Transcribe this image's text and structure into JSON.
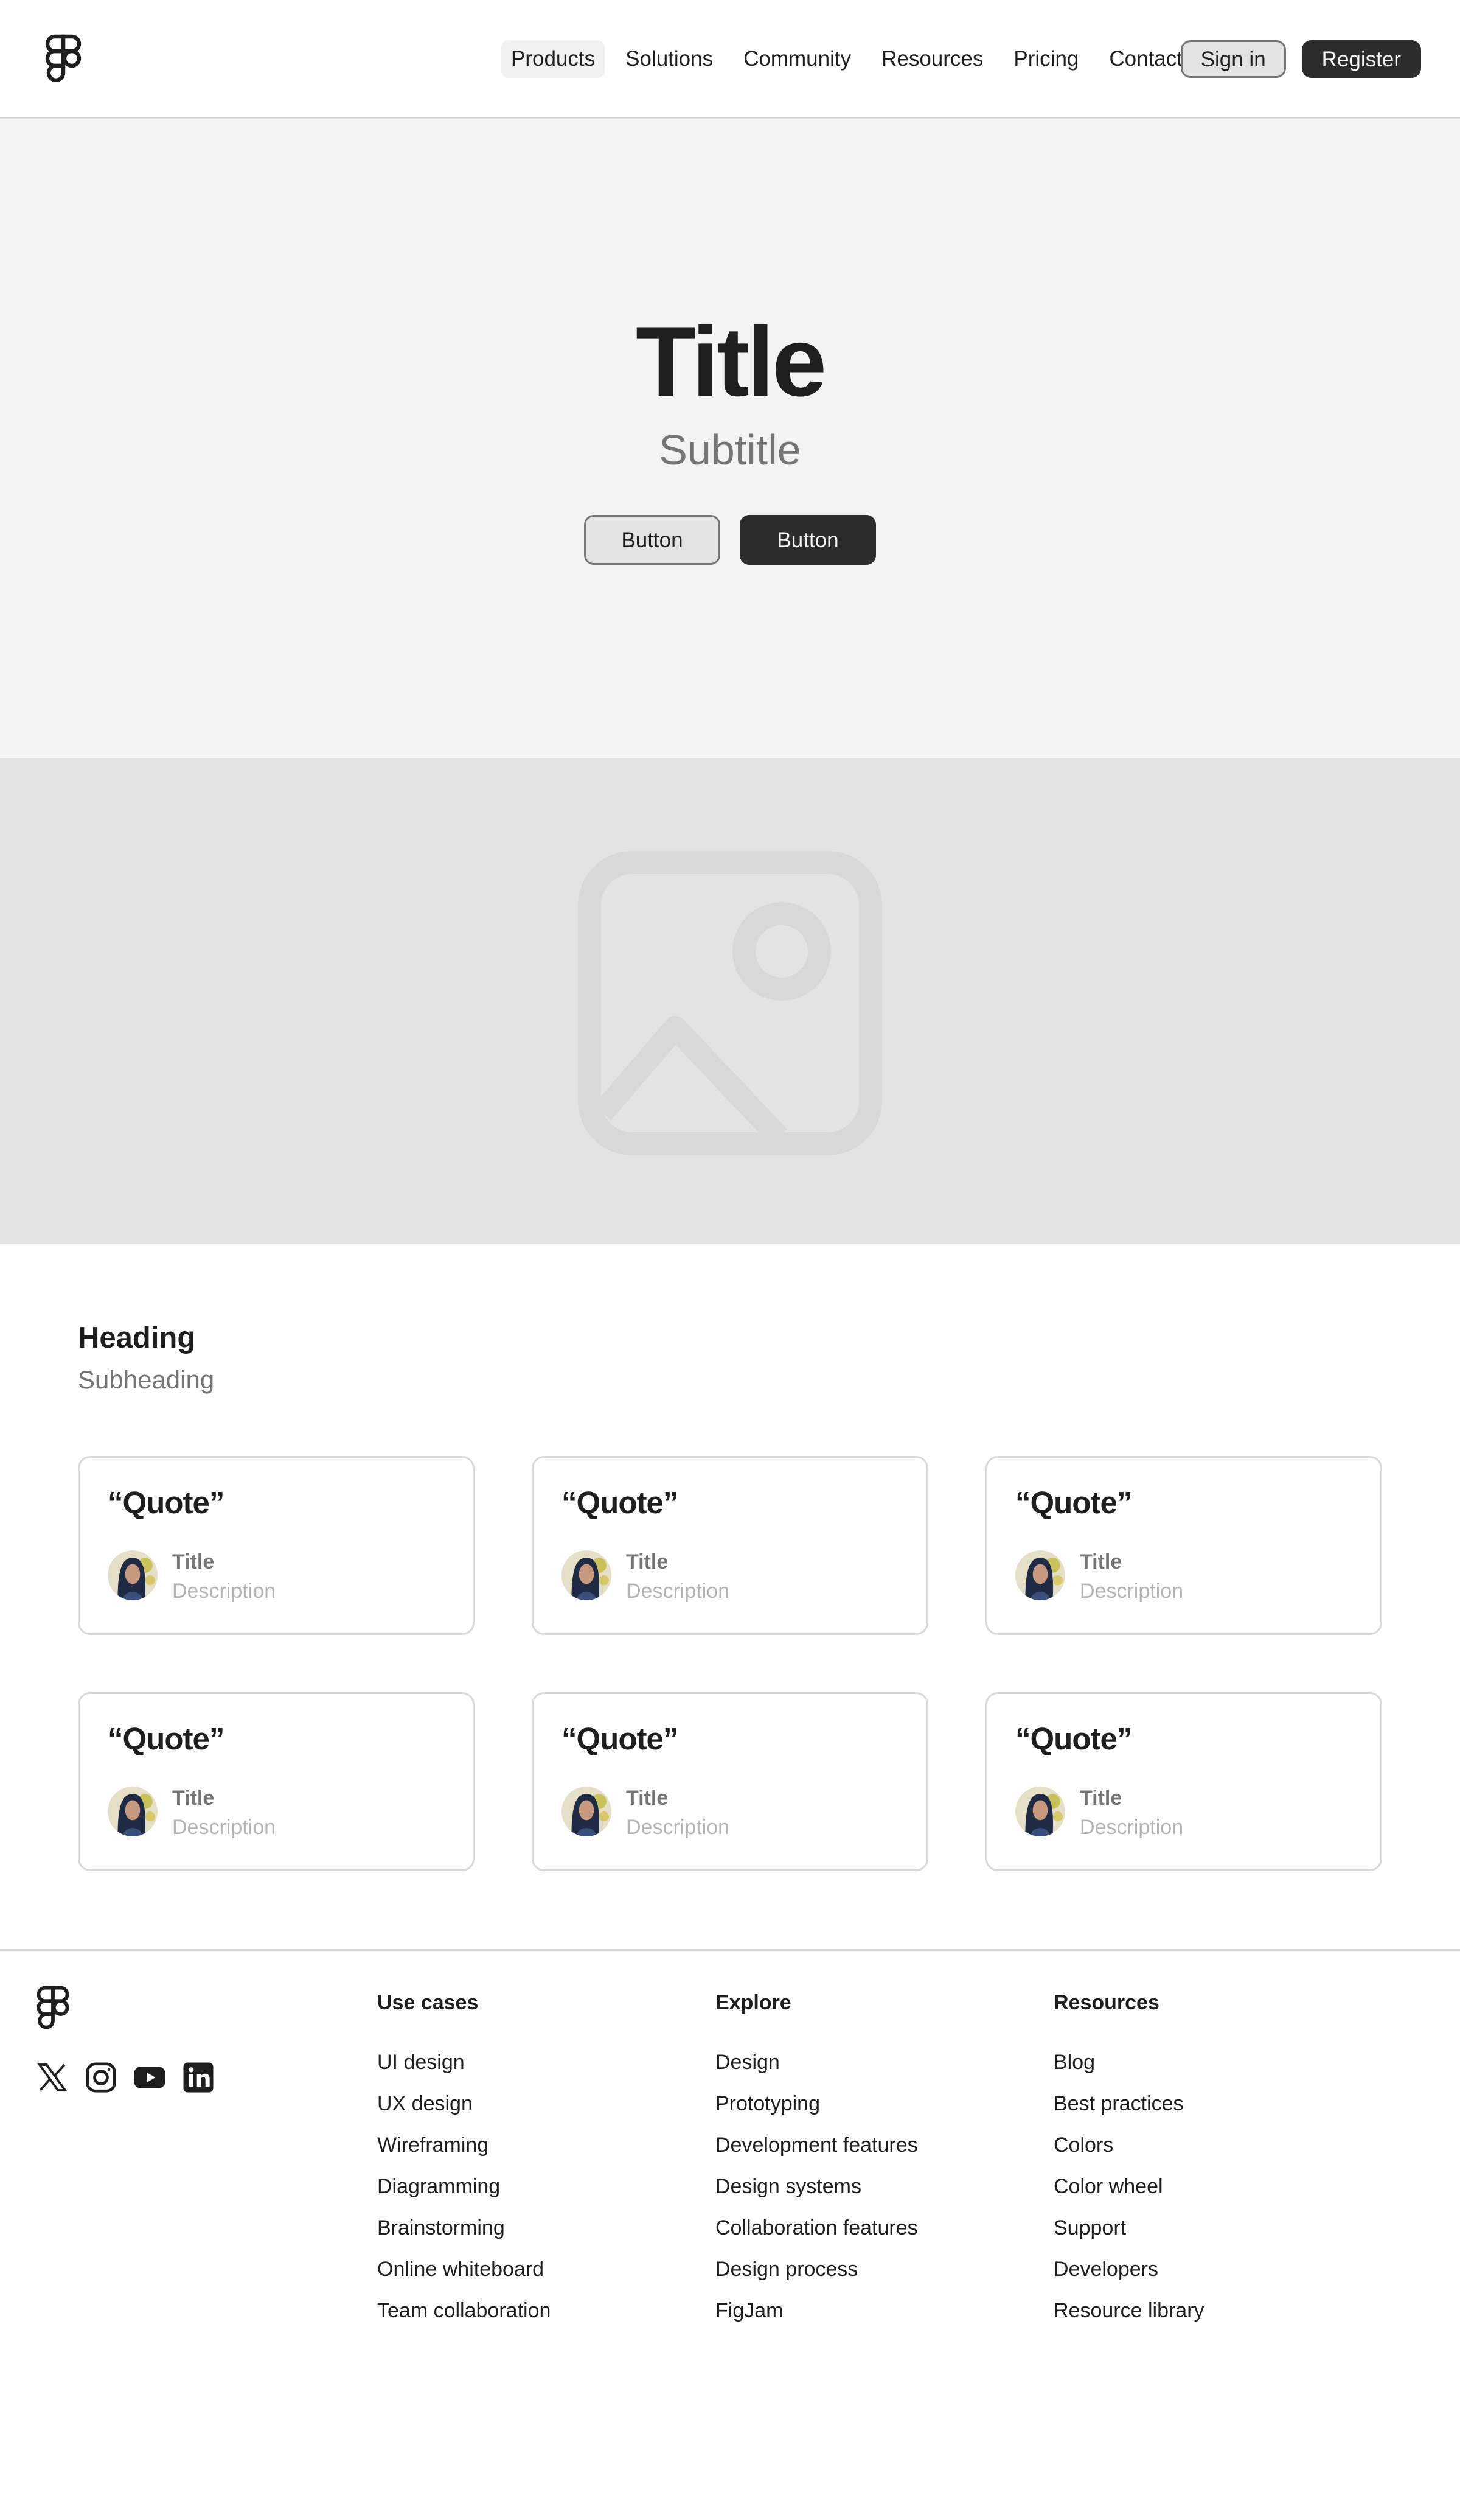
{
  "nav": {
    "items": [
      "Products",
      "Solutions",
      "Community",
      "Resources",
      "Pricing",
      "Contact"
    ],
    "active": "Products"
  },
  "header": {
    "sign_in": "Sign in",
    "register": "Register"
  },
  "hero": {
    "title": "Title",
    "subtitle": "Subtitle",
    "button_secondary": "Button",
    "button_primary": "Button"
  },
  "image_placeholder": {
    "icon": "image-icon"
  },
  "testimonials": {
    "heading": "Heading",
    "subheading": "Subheading",
    "cards": [
      {
        "quote": "“Quote”",
        "title": "Title",
        "description": "Description"
      },
      {
        "quote": "“Quote”",
        "title": "Title",
        "description": "Description"
      },
      {
        "quote": "“Quote”",
        "title": "Title",
        "description": "Description"
      },
      {
        "quote": "“Quote”",
        "title": "Title",
        "description": "Description"
      },
      {
        "quote": "“Quote”",
        "title": "Title",
        "description": "Description"
      },
      {
        "quote": "“Quote”",
        "title": "Title",
        "description": "Description"
      }
    ]
  },
  "footer": {
    "socials": [
      "x-icon",
      "instagram-icon",
      "youtube-icon",
      "linkedin-icon"
    ],
    "columns": [
      {
        "title": "Use cases",
        "links": [
          "UI design",
          "UX design",
          "Wireframing",
          "Diagramming",
          "Brainstorming",
          "Online whiteboard",
          "Team collaboration"
        ]
      },
      {
        "title": "Explore",
        "links": [
          "Design",
          "Prototyping",
          "Development features",
          "Design systems",
          "Collaboration features",
          "Design process",
          "FigJam"
        ]
      },
      {
        "title": "Resources",
        "links": [
          "Blog",
          "Best practices",
          "Colors",
          "Color wheel",
          "Support",
          "Developers",
          "Resource library"
        ]
      }
    ]
  },
  "colors": {
    "primary": "#2c2c2c",
    "hero_bg": "#f3f3f3",
    "image_bg": "#e3e3e3",
    "muted_text": "#757575",
    "border": "#d9d9d9"
  }
}
